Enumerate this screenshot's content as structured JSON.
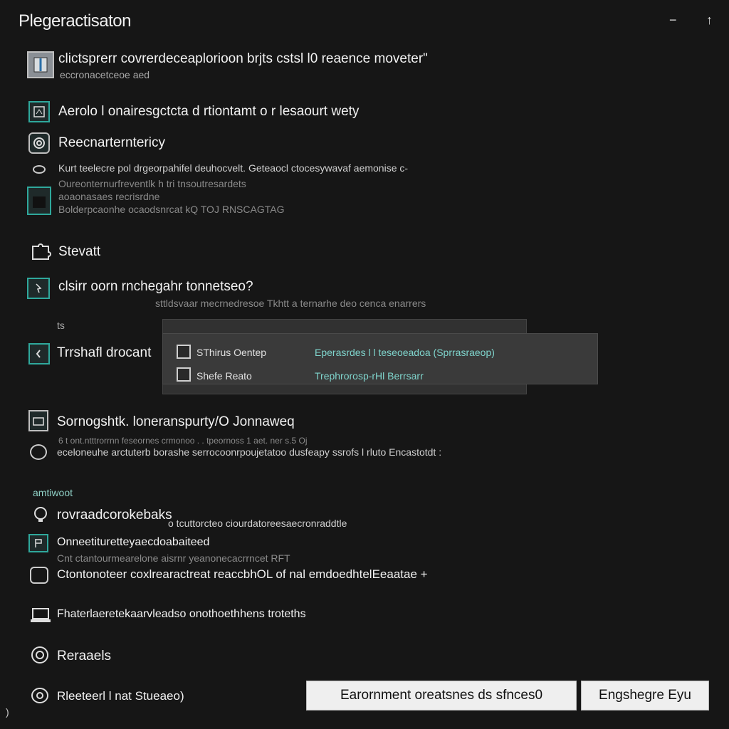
{
  "window": {
    "title": "Plegeractisaton",
    "minimize_glyph": "−",
    "pin_glyph": "↑"
  },
  "rows": [
    {
      "icon": "document-icon",
      "main": "clictsprerr covrerdeceaplorioon brjts cstsl l0 reaence moveter\"",
      "sub": "eccronacetceoe aed"
    },
    {
      "icon": "image-icon",
      "main": "Aerolo l onairesgctcta d rtiontamt o r lesaourt wety"
    },
    {
      "icon": "spiral-icon",
      "main": "Reecnarterntericy"
    },
    {
      "icon": "dot-icon",
      "main": "Kurt teelecre pol drgeorpahifel deuhocvelt. Geteaocl ctocesywavaf aemonise c-"
    },
    {
      "icon": "panel-icon",
      "lines": [
        "Oureonternurfreventlk h tri tnsoutresardets",
        "aoaonasaes recrisrdne",
        "Bolderpcaonhe ocaodsnrcat kQ TOJ RNSCAGTAG"
      ]
    },
    {
      "icon": "puzzle-icon",
      "main": "Stevatt"
    },
    {
      "icon": "cursor-icon",
      "main": "clsirr oorn rnchegahr tonnetseo?",
      "sub": "sttldsvaar mecrnedresoe Tkhtt a ternarhe deo cenca enarrers"
    },
    {
      "icon": "tag-icon",
      "main": "Trrshafl drocant",
      "sub": "ts"
    },
    {
      "icon": "folder-icon",
      "main": "Sornogshtk. loneranspurty/O Jonnaweq",
      "sub": "6 t ont.ntttrorrnn feseornes crmonoo . . tpeornoss 1 aet. ner s.5 Oj",
      "line2": "eceloneuhe arctuterb borashe serrocoonrpoujetatoo dusfeapy ssrofs l rluto Encastotdt :"
    },
    {
      "icon": "",
      "main": "amtiwoot"
    },
    {
      "icon": "bulb-icon",
      "main": "rovraadcorokebaks",
      "sub": "o tcuttorcteo ciourdatoreesaecronraddtle"
    },
    {
      "icon": "flag-icon",
      "main": "Onneetituretteyaecdoabaiteed",
      "sub": "Cnt ctantourmearelone aisrnr yeanonecacrrncet RFT"
    },
    {
      "icon": "bracket-icon",
      "main": "Ctontonoteer coxlrearactreat reaccbhOL of nal emdoedhtelEeaatae +"
    },
    {
      "icon": "laptop-icon",
      "main": "Fhaterlaeretekaarvleadso onothoethhens troteths"
    },
    {
      "icon": "spiral-icon",
      "main": "Reraaels"
    },
    {
      "icon": "spiral-icon",
      "main": "Rleeteerl l nat Stueaeo)"
    }
  ],
  "popup": {
    "items": [
      {
        "label": "SThirus Oentep",
        "value": "Eperasrdes l l teseoeadoa (Sprrasraeop)"
      },
      {
        "label": "Shefe Reato",
        "value": "Trephrorosp-rHl Berrsarr"
      }
    ]
  },
  "footer": {
    "primary_label": "Earornment oreatsnes ds sfnces0",
    "secondary_label": "Engshegre Eyu"
  },
  "corner_glyph": ")"
}
